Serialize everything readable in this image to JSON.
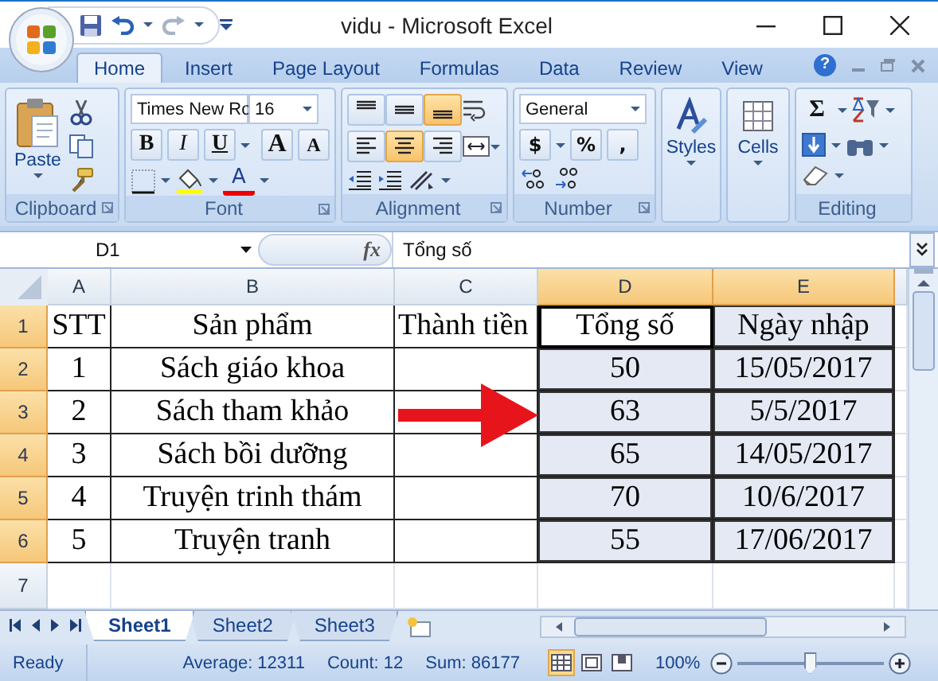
{
  "window": {
    "title": "vidu - Microsoft Excel"
  },
  "tabs": [
    {
      "label": "Home",
      "selected": true
    },
    {
      "label": "Insert",
      "selected": false
    },
    {
      "label": "Page Layout",
      "selected": false
    },
    {
      "label": "Formulas",
      "selected": false
    },
    {
      "label": "Data",
      "selected": false
    },
    {
      "label": "Review",
      "selected": false
    },
    {
      "label": "View",
      "selected": false
    }
  ],
  "help": "?",
  "ribbon": {
    "clipboard": {
      "paste": "Paste",
      "label": "Clipboard"
    },
    "font": {
      "name": "Times New Ro",
      "size": "16",
      "styles": [
        "B",
        "I",
        "U"
      ],
      "grow": "A",
      "shrink": "A",
      "font_color": "A",
      "label": "Font"
    },
    "alignment": {
      "vertical": [
        {
          "selected": false
        },
        {
          "selected": false
        },
        {
          "selected": true
        }
      ],
      "horizontal": [
        {
          "selected": false
        },
        {
          "selected": true
        },
        {
          "selected": false
        }
      ],
      "label": "Alignment"
    },
    "number": {
      "format": "General",
      "symbols": [
        "$",
        "%",
        ","
      ],
      "label": "Number"
    },
    "styles": "Styles",
    "cells": "Cells",
    "editing": {
      "sum": "Σ",
      "label": "Editing"
    }
  },
  "formula_bar": {
    "name_box": "D1",
    "fx": "fx",
    "value": "Tổng số"
  },
  "grid": {
    "columns": [
      {
        "label": "A",
        "selected": false
      },
      {
        "label": "B",
        "selected": false
      },
      {
        "label": "C",
        "selected": false
      },
      {
        "label": "D",
        "selected": true
      },
      {
        "label": "E",
        "selected": true
      }
    ],
    "rows": [
      {
        "header": "1",
        "selected": true,
        "cells": [
          {
            "text": "STT",
            "selected": false,
            "active": false
          },
          {
            "text": "Sản phẩm",
            "selected": false,
            "active": false
          },
          {
            "text": "Thành tiền",
            "selected": false,
            "active": false
          },
          {
            "text": "Tổng số",
            "selected": true,
            "active": true
          },
          {
            "text": "Ngày nhập",
            "selected": true,
            "active": false
          }
        ]
      },
      {
        "header": "2",
        "selected": true,
        "cells": [
          {
            "text": "1",
            "selected": false,
            "active": false
          },
          {
            "text": "Sách giáo khoa",
            "selected": false,
            "active": false
          },
          {
            "selected": false,
            "active": false
          },
          {
            "text": "50",
            "selected": true,
            "active": false
          },
          {
            "text": "15/05/2017",
            "selected": true,
            "active": false
          }
        ]
      },
      {
        "header": "3",
        "selected": true,
        "cells": [
          {
            "text": "2",
            "selected": false,
            "active": false
          },
          {
            "text": "Sách tham khảo",
            "selected": false,
            "active": false
          },
          {
            "selected": false,
            "active": false
          },
          {
            "text": "63",
            "selected": true,
            "active": false
          },
          {
            "text": "5/5/2017",
            "selected": true,
            "active": false
          }
        ]
      },
      {
        "header": "4",
        "selected": true,
        "cells": [
          {
            "text": "3",
            "selected": false,
            "active": false
          },
          {
            "text": "Sách bồi dưỡng",
            "selected": false,
            "active": false
          },
          {
            "selected": false,
            "active": false
          },
          {
            "text": "65",
            "selected": true,
            "active": false
          },
          {
            "text": "14/05/2017",
            "selected": true,
            "active": false
          }
        ]
      },
      {
        "header": "5",
        "selected": true,
        "cells": [
          {
            "text": "4",
            "selected": false,
            "active": false
          },
          {
            "text": "Truyện trinh thám",
            "selected": false,
            "active": false
          },
          {
            "selected": false,
            "active": false
          },
          {
            "text": "70",
            "selected": true,
            "active": false
          },
          {
            "text": "10/6/2017",
            "selected": true,
            "active": false
          }
        ]
      },
      {
        "header": "6",
        "selected": true,
        "cells": [
          {
            "text": "5",
            "selected": false,
            "active": false
          },
          {
            "text": "Truyện tranh",
            "selected": false,
            "active": false
          },
          {
            "selected": false,
            "active": false
          },
          {
            "text": "55",
            "selected": true,
            "active": false
          },
          {
            "text": "17/06/2017",
            "selected": true,
            "active": false
          }
        ]
      },
      {
        "header": "7",
        "selected": false
      }
    ]
  },
  "sheet_tabs": [
    {
      "label": "Sheet1",
      "selected": true
    },
    {
      "label": "Sheet2",
      "selected": false
    },
    {
      "label": "Sheet3",
      "selected": false
    }
  ],
  "status_bar": {
    "state": "Ready",
    "average": "Average: 12311",
    "count": "Count: 12",
    "sum": "Sum: 86177",
    "views": [
      {
        "selected": true
      },
      {
        "selected": false
      },
      {
        "selected": false
      }
    ],
    "zoom": "100%",
    "zoom_level": {
      "level": 0.5
    }
  }
}
